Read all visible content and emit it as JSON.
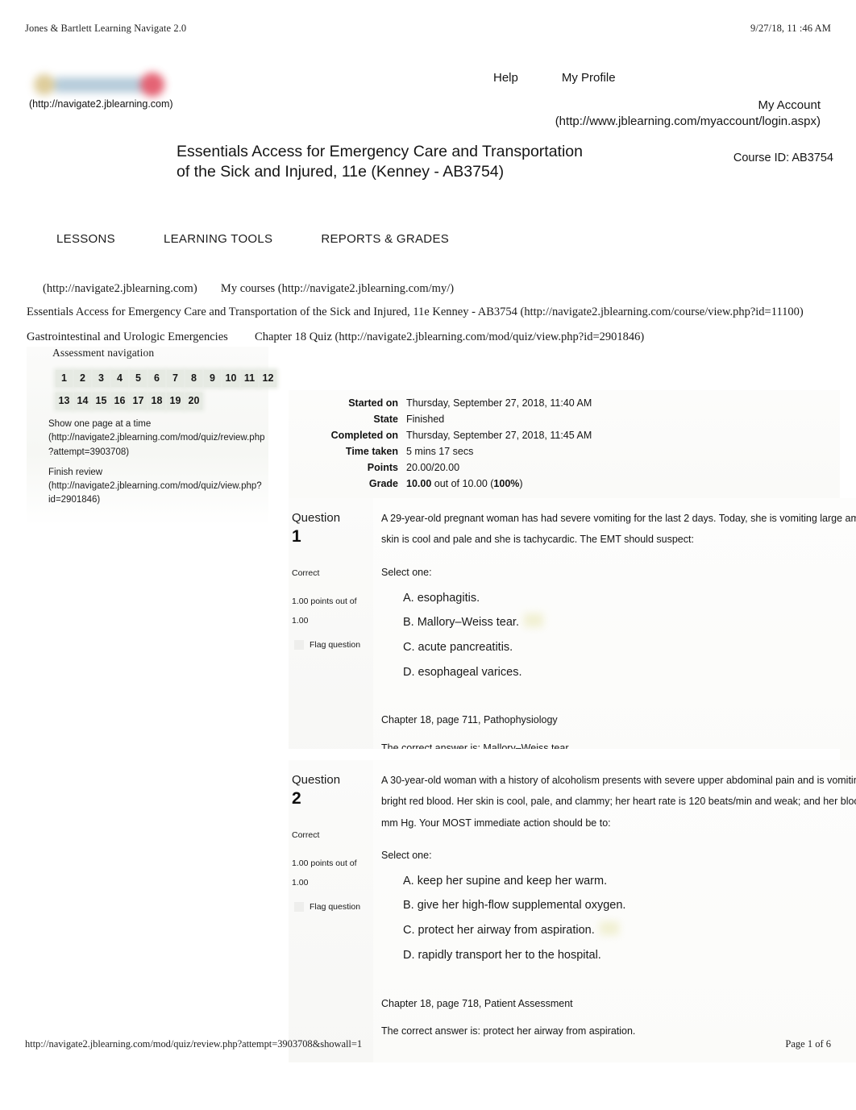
{
  "print": {
    "header_left": "Jones & Bartlett Learning Navigate 2.0",
    "header_right": "9/27/18, 11  :46 AM",
    "footer_url": "http://navigate2.jblearning.com/mod/quiz/review.php?attempt=3903708&showall=1",
    "footer_page": "Page 1 of 6"
  },
  "branding": {
    "logo_name": "jones-bartlett-navigate-logo",
    "logo_caption": "(http://navigate2.jblearning.com)",
    "colors": {
      "logo_gold": "#d8c48a",
      "logo_blue": "#a9c3d4",
      "logo_red": "#e0485c",
      "nav_chip": "#e6eae3",
      "highlight": "#efeecb"
    }
  },
  "toplinks": {
    "help": "Help",
    "my_profile": "My Profile",
    "my_account": "My Account",
    "my_account_url": "(http://www.jblearning.com/myaccount/login.aspx)"
  },
  "course": {
    "title_line1": "Essentials Access for Emergency Care and Transportation",
    "title_line2": "of the Sick and Injured, 11e (Kenney - AB3754)",
    "course_id": "Course ID: AB3754"
  },
  "mainnav": {
    "items": [
      {
        "label": "LESSONS"
      },
      {
        "label": "LEARNING TOOLS"
      },
      {
        "label": "REPORTS & GRADES"
      }
    ]
  },
  "breadcrumbs": {
    "home": "(http://navigate2.jblearning.com)",
    "my_courses": "My courses (http://navigate2.jblearning.com/my/)",
    "course": "Essentials Access for Emergency Care and Transportation of the Sick and Injured, 11e Kenney - AB3754  (http://navigate2.jblearning.com/course/view.php?id=11100)",
    "section": "Gastrointestinal and Urologic Emergencies",
    "activity": "Chapter 18 Quiz (http://navigate2.jblearning.com/mod/quiz/view.php?id=2901846)"
  },
  "assessment_nav": {
    "title": "Assessment navigation",
    "row1": [
      "1",
      "2",
      "3",
      "4",
      "5",
      "6",
      "7",
      "8",
      "9",
      "10",
      "11",
      "12"
    ],
    "row2": [
      "13",
      "14",
      "15",
      "16",
      "17",
      "18",
      "19",
      "20"
    ],
    "show_one_page": "Show one page at a time (http://navigate2.jblearning.com/mod/quiz/review.php?attempt=3903708)",
    "finish_review": "Finish review (http://navigate2.jblearning.com/mod/quiz/view.php?id=2901846)"
  },
  "summary": {
    "rows": [
      {
        "label": "Started on",
        "value": "Thursday, September 27, 2018, 11:40 AM"
      },
      {
        "label": "State",
        "value": "Finished"
      },
      {
        "label": "Completed on",
        "value": "Thursday, September 27, 2018, 11:45 AM"
      },
      {
        "label": "Time taken",
        "value": "5 mins 17 secs"
      },
      {
        "label": "Points",
        "value": "20.00/20.00"
      }
    ],
    "grade_label": "Grade",
    "grade_value": "10.00",
    "grade_middle": " out of 10.00 (",
    "grade_percent": "100%",
    "grade_close": ")"
  },
  "questions": [
    {
      "heading": "Question",
      "number": "1",
      "status": "Correct",
      "points_line1": "1.00 points out of",
      "points_line2": "1.00",
      "flag_label": "Flag question",
      "stem_line1": "A 29-year-old pregnant woman has had severe vomiting for the last 2 days. Today, she is vomiting large amounts",
      "stem_line2": "skin is cool and pale and she is tachycardic. The EMT should suspect:",
      "select_one": "Select one:",
      "answers": [
        {
          "text": "A. esophagitis.",
          "highlighted": false
        },
        {
          "text": "B. Mallory–Weiss tear.",
          "highlighted": true
        },
        {
          "text": "C. acute pancreatitis.",
          "highlighted": false
        },
        {
          "text": "D. esophageal varices.",
          "highlighted": false
        }
      ],
      "reference": "Chapter 18, page 711, Pathophysiology",
      "correct_answer": "The correct answer is: Mallory–Weiss tear."
    },
    {
      "heading": "Question",
      "number": "2",
      "status": "Correct",
      "points_line1": "1.00 points out of",
      "points_line2": "1.00",
      "flag_label": "Flag question",
      "stem_line1": "A 30-year-old woman with a history of alcoholism presents with severe upper abdominal pain and is vomiting large",
      "stem_line2": "bright red blood. Her skin is cool, pale, and clammy; her heart rate is 120 beats/min and weak; and her blood pres",
      "stem_line3": "mm Hg. Your MOST immediate action should be to:",
      "select_one": "Select one:",
      "answers": [
        {
          "text": "A. keep her supine and keep her warm.",
          "highlighted": false
        },
        {
          "text": "B. give her high-flow supplemental oxygen.",
          "highlighted": false
        },
        {
          "text": "C. protect her airway from aspiration.",
          "highlighted": true
        },
        {
          "text": "D. rapidly transport her to the hospital.",
          "highlighted": false
        }
      ],
      "reference": "Chapter 18, page 718, Patient Assessment",
      "correct_answer": "The correct answer is: protect her airway from aspiration."
    }
  ]
}
